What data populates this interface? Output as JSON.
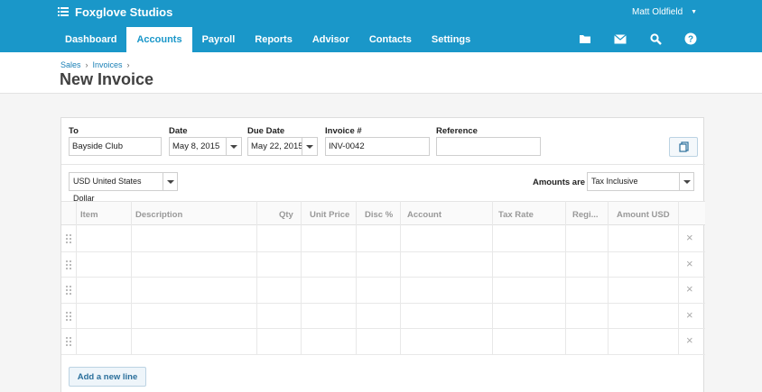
{
  "app": {
    "org_name": "Foxglove Studios",
    "user_name": "Matt Oldfield"
  },
  "nav": {
    "items": [
      {
        "label": "Dashboard"
      },
      {
        "label": "Accounts"
      },
      {
        "label": "Payroll"
      },
      {
        "label": "Reports"
      },
      {
        "label": "Advisor"
      },
      {
        "label": "Contacts"
      },
      {
        "label": "Settings"
      }
    ],
    "active": "Accounts",
    "icons": [
      "folder-icon",
      "mail-icon",
      "search-icon",
      "help-icon"
    ]
  },
  "breadcrumb": [
    "Sales",
    "Invoices"
  ],
  "page": {
    "title": "New Invoice"
  },
  "form": {
    "to_label": "To",
    "to_value": "Bayside Club",
    "date_label": "Date",
    "date_value": "May 8, 2015",
    "due_label": "Due Date",
    "due_value": "May 22, 2015",
    "invoice_label": "Invoice #",
    "invoice_value": "INV-0042",
    "reference_label": "Reference",
    "reference_value": "",
    "currency": "USD United States Dollar",
    "amounts_label": "Amounts are",
    "amounts_value": "Tax Inclusive"
  },
  "table": {
    "columns": [
      "Item",
      "Description",
      "Qty",
      "Unit Price",
      "Disc %",
      "Account",
      "Tax Rate",
      "Regi...",
      "Amount USD"
    ],
    "empty_rows": 5
  },
  "buttons": {
    "add_line": "Add a new line"
  },
  "colors": {
    "brand": "#1a97c9",
    "link": "#1a80b6"
  }
}
